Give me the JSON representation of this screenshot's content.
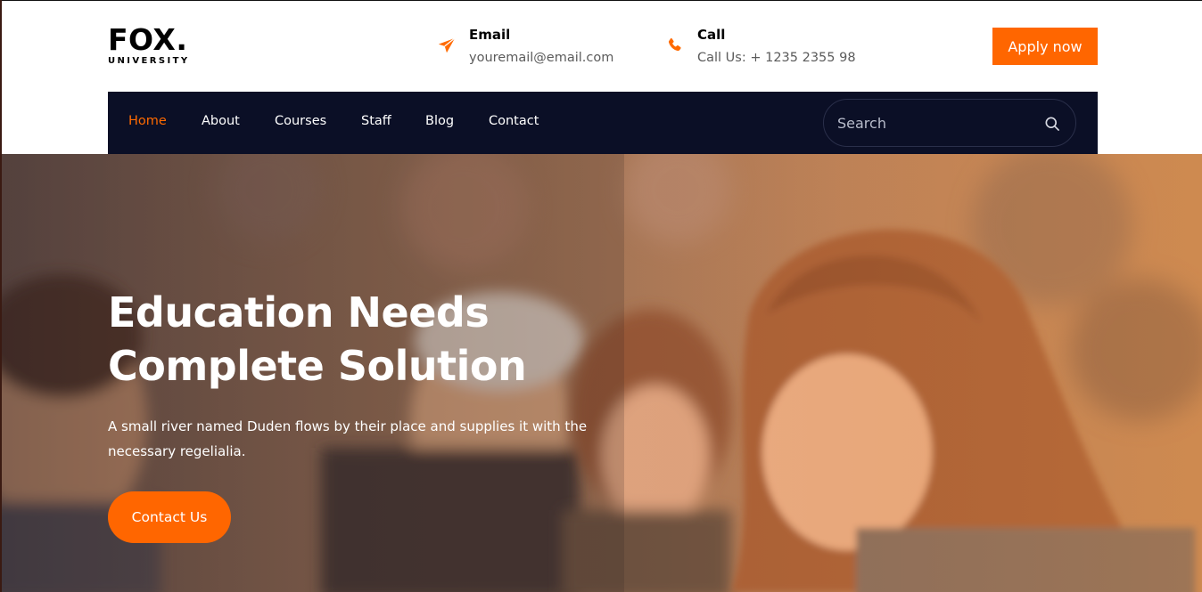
{
  "header": {
    "logo": {
      "main": "FOX.",
      "sub": "UNIVERSITY"
    },
    "email": {
      "title": "Email",
      "value": "youremail@email.com",
      "icon": "paper-plane-icon"
    },
    "call": {
      "title": "Call",
      "value": "Call Us: + 1235 2355 98",
      "icon": "phone-icon"
    },
    "apply_label": "Apply now"
  },
  "nav": {
    "items": [
      {
        "label": "Home",
        "active": true
      },
      {
        "label": "About",
        "active": false
      },
      {
        "label": "Courses",
        "active": false
      },
      {
        "label": "Staff",
        "active": false
      },
      {
        "label": "Blog",
        "active": false
      },
      {
        "label": "Contact",
        "active": false
      }
    ],
    "search": {
      "placeholder": "Search",
      "icon": "search-icon"
    }
  },
  "hero": {
    "title_line1": "Education Needs",
    "title_line2": "Complete Solution",
    "subtitle": "A small river named Duden flows by their place and supplies it with the necessary regelialia.",
    "button_label": "Contact Us"
  },
  "colors": {
    "accent": "#ff6600",
    "nav_bg": "#0b0f26",
    "text_dark": "#000000",
    "text_muted": "#5b5b5b"
  }
}
